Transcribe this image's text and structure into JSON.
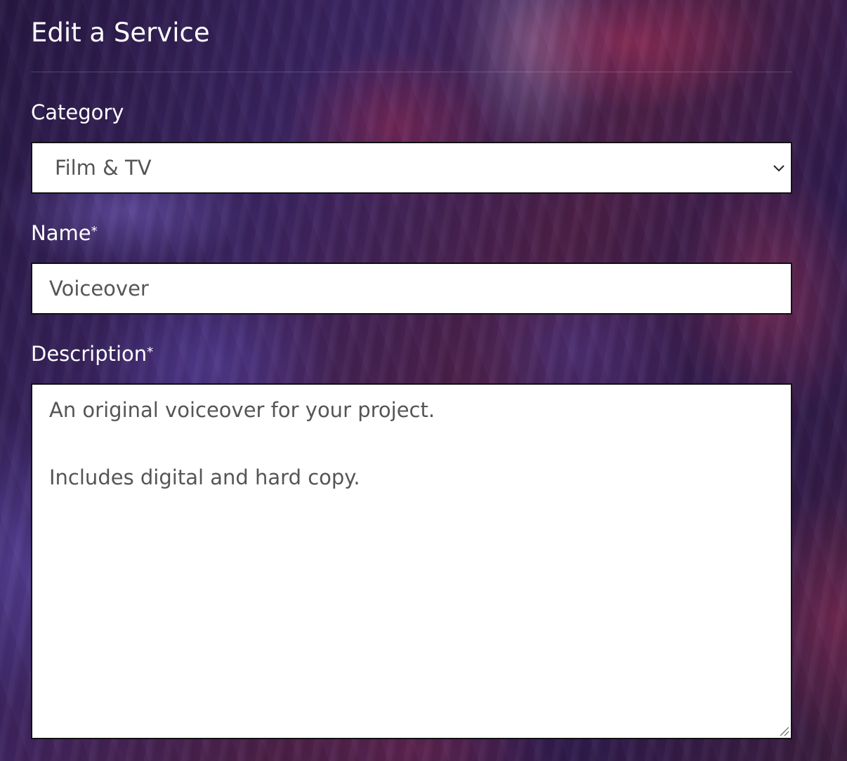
{
  "form": {
    "title": "Edit a Service",
    "category": {
      "label": "Category",
      "selected": "Film & TV"
    },
    "name": {
      "label": "Name",
      "required_mark": "*",
      "value": "Voiceover"
    },
    "description": {
      "label": "Description",
      "required_mark": "*",
      "lines": [
        "An original voiceover for your project.",
        "",
        "Includes digital and hard copy."
      ]
    }
  },
  "icons": {
    "select_arrow": "chevron-down-icon",
    "textarea_grip": "resize-grip-icon"
  },
  "colors": {
    "label_text": "#ffffff",
    "field_text": "#555555",
    "field_background": "#ffffff",
    "field_border": "#111111"
  }
}
